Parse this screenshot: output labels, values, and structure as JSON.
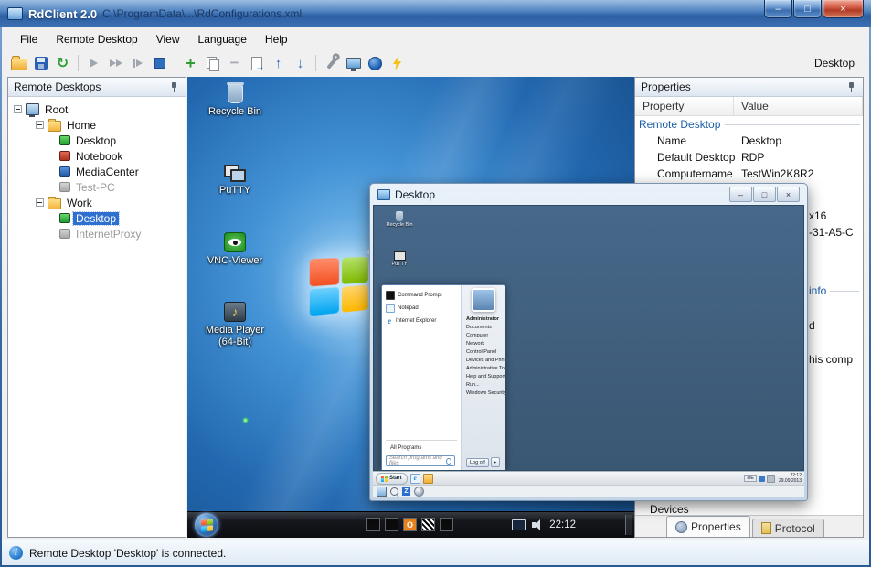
{
  "window": {
    "title": "RdClient 2.0",
    "title_path": "C:\\ProgramData\\...\\RdConfigurations.xml",
    "controls": {
      "minimize": "–",
      "maximize": "□",
      "close": "×"
    }
  },
  "menu": {
    "items": [
      "File",
      "Remote Desktop",
      "View",
      "Language",
      "Help"
    ]
  },
  "toolbar": {
    "selected_desktop_label": "Desktop"
  },
  "tree_panel": {
    "header": "Remote Desktops",
    "nodes": [
      {
        "label": "Root",
        "level": 0,
        "icon": "computer",
        "expander": true
      },
      {
        "label": "Home",
        "level": 1,
        "icon": "folder",
        "expander": true
      },
      {
        "label": "Desktop",
        "level": 2,
        "icon": "monitor-green"
      },
      {
        "label": "Notebook",
        "level": 2,
        "icon": "monitor-red"
      },
      {
        "label": "MediaCenter",
        "level": 2,
        "icon": "monitor-blue"
      },
      {
        "label": "Test-PC",
        "level": 2,
        "icon": "monitor-gray",
        "muted": true
      },
      {
        "label": "Work",
        "level": 1,
        "icon": "folder",
        "expander": true
      },
      {
        "label": "Desktop",
        "level": 2,
        "icon": "monitor-green",
        "selected": true
      },
      {
        "label": "InternetProxy",
        "level": 2,
        "icon": "monitor-gray",
        "muted": true
      }
    ]
  },
  "remote_desktop": {
    "icons": [
      {
        "label": "Recycle Bin",
        "icon": "recycle-bin-icon"
      },
      {
        "label": "PuTTY",
        "icon": "putty-icon"
      },
      {
        "label": "VNC-Viewer",
        "icon": "vnc-viewer-icon"
      },
      {
        "label": "Media Player (64-Bit)",
        "icon": "media-player-icon"
      }
    ],
    "taskbar": {
      "clock": "22:12",
      "tray_squares": [
        {
          "glyph": "",
          "style": "dark"
        },
        {
          "glyph": "",
          "style": "dark"
        },
        {
          "glyph": "O",
          "style": "orange"
        },
        {
          "glyph": "",
          "style": "checker"
        },
        {
          "glyph": "",
          "style": "dark"
        }
      ]
    }
  },
  "session_window": {
    "title": "Desktop",
    "controls": {
      "minimize": "–",
      "maximize": "□",
      "close": "×"
    },
    "desktop_icons": [
      {
        "label": "Recycle Bin"
      },
      {
        "label": "PuTTY"
      }
    ],
    "start_menu": {
      "left_items": [
        "Command Prompt",
        "Notepad",
        "Internet Explorer"
      ],
      "all_programs_label": "All Programs",
      "search_placeholder": "Search programs and files",
      "right_items": [
        "Administrator",
        "Documents",
        "Computer",
        "Network",
        "Control Panel",
        "Devices and Printers",
        "Administrative Tools",
        "Help and Support",
        "Run...",
        "Windows Security"
      ],
      "log_off_label": "Log off"
    },
    "taskbar": {
      "start_label": "Start",
      "language": "DE",
      "clock": "22:12",
      "date": "29.09.2013"
    }
  },
  "properties_panel": {
    "header": "Properties",
    "columns": {
      "property": "Property",
      "value": "Value"
    },
    "section_title": "Remote Desktop",
    "rows": [
      {
        "property": "Name",
        "value": "Desktop"
      },
      {
        "property": "Default Desktop",
        "value": "RDP"
      },
      {
        "property": "Computername",
        "value": "TestWin2K8R2"
      }
    ],
    "clipped_fragments": [
      {
        "text": "x16"
      },
      {
        "text": "-31-A5-C"
      },
      {
        "text": "info",
        "section": true
      },
      {
        "text": "d"
      },
      {
        "text": "his comp"
      },
      {
        "text": "Devices"
      }
    ],
    "tabs": [
      {
        "label": "Properties",
        "active": true
      },
      {
        "label": "Protocol",
        "active": false
      }
    ]
  },
  "status_bar": {
    "text": "Remote Desktop 'Desktop' is connected."
  }
}
